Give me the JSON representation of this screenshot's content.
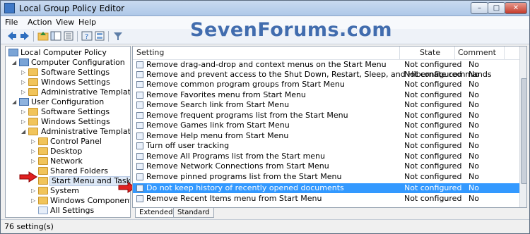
{
  "window": {
    "title": "Local Group Policy Editor",
    "min_glyph": "–",
    "max_glyph": "□",
    "close_glyph": "✕"
  },
  "watermark": "SevenForums.com",
  "menu": {
    "file": "File",
    "action": "Action",
    "view": "View",
    "help": "Help"
  },
  "toolbar_icons": [
    "back-icon",
    "forward-icon",
    "up-folder-icon",
    "show-hide-tree-icon",
    "export-list-icon",
    "help-icon",
    "properties-icon",
    "filter-icon"
  ],
  "tree": {
    "root": "Local Computer Policy",
    "computer_configuration": "Computer Configuration",
    "cc_software_settings": "Software Settings",
    "cc_windows_settings": "Windows Settings",
    "cc_administrative_templates": "Administrative Templates",
    "user_configuration": "User Configuration",
    "uc_software_settings": "Software Settings",
    "uc_windows_settings": "Windows Settings",
    "uc_administrative_templates": "Administrative Templates",
    "control_panel": "Control Panel",
    "desktop": "Desktop",
    "network": "Network",
    "shared_folders": "Shared Folders",
    "start_menu_and_taskbar": "Start Menu and Taskbar",
    "system": "System",
    "windows_components": "Windows Components",
    "all_settings": "All Settings"
  },
  "list": {
    "headers": {
      "setting": "Setting",
      "state": "State",
      "comment": "Comment"
    },
    "rows": [
      {
        "setting": "Remove drag-and-drop and context menus on the Start Menu",
        "state": "Not configured",
        "comment": "No"
      },
      {
        "setting": "Remove and prevent access to the Shut Down, Restart, Sleep, and Hibernate commands",
        "state": "Not configured",
        "comment": "No"
      },
      {
        "setting": "Remove common program groups from Start Menu",
        "state": "Not configured",
        "comment": "No"
      },
      {
        "setting": "Remove Favorites menu from Start Menu",
        "state": "Not configured",
        "comment": "No"
      },
      {
        "setting": "Remove Search link from Start Menu",
        "state": "Not configured",
        "comment": "No"
      },
      {
        "setting": "Remove frequent programs list from the Start Menu",
        "state": "Not configured",
        "comment": "No"
      },
      {
        "setting": "Remove Games link from Start Menu",
        "state": "Not configured",
        "comment": "No"
      },
      {
        "setting": "Remove Help menu from Start Menu",
        "state": "Not configured",
        "comment": "No"
      },
      {
        "setting": "Turn off user tracking",
        "state": "Not configured",
        "comment": "No"
      },
      {
        "setting": "Remove All Programs list from the Start menu",
        "state": "Not configured",
        "comment": "No"
      },
      {
        "setting": "Remove Network Connections from Start Menu",
        "state": "Not configured",
        "comment": "No"
      },
      {
        "setting": "Remove pinned programs list from the Start Menu",
        "state": "Not configured",
        "comment": "No"
      },
      {
        "setting": "Do not keep history of recently opened documents",
        "state": "Not configured",
        "comment": "No"
      },
      {
        "setting": "Remove Recent Items menu from Start Menu",
        "state": "Not configured",
        "comment": "No"
      }
    ]
  },
  "tabs": {
    "extended": "Extended",
    "standard": "Standard"
  },
  "status": "76 setting(s)",
  "colors": {
    "selection": "#3399ff",
    "annotation_arrow": "#e02020",
    "watermark": "#2f5ea6"
  }
}
